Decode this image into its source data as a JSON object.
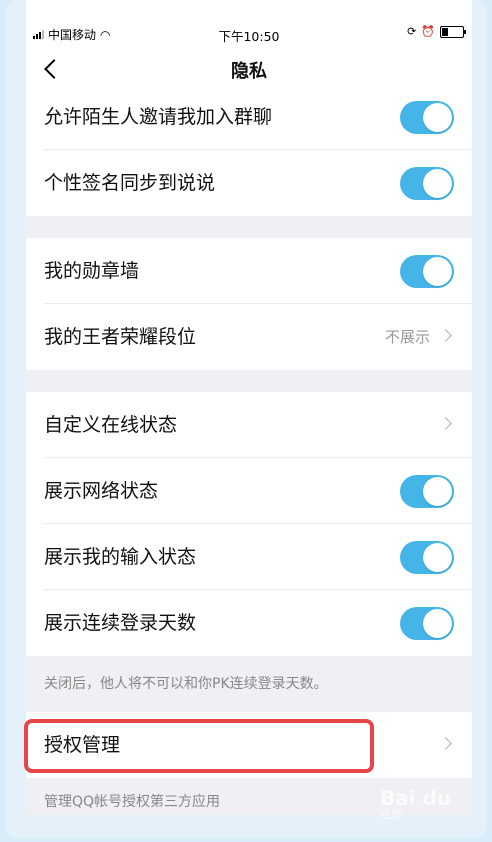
{
  "status_bar": {
    "carrier": "中国移动",
    "time": "下午10:50"
  },
  "nav": {
    "title": "隐私"
  },
  "rows": [
    {
      "label": "允许陌生人邀请我加入群聊",
      "toggle": true
    },
    {
      "label": "个性签名同步到说说",
      "toggle": true
    },
    {
      "label": "我的勋章墙",
      "toggle": true
    },
    {
      "label": "我的王者荣耀段位",
      "value": "不展示"
    },
    {
      "label": "自定义在线状态"
    },
    {
      "label": "展示网络状态",
      "toggle": true
    },
    {
      "label": "展示我的输入状态",
      "toggle": true
    },
    {
      "label": "展示连续登录天数",
      "toggle": true
    },
    {
      "label": "授权管理"
    }
  ],
  "footnotes": {
    "login_days": "关闭后，他人将不可以和你PK连续登录天数。",
    "auth": "管理QQ帐号授权第三方应用"
  },
  "watermark": {
    "text": "Bai du",
    "sub": "经验"
  },
  "colors": {
    "toggle_on": "#45b5e8",
    "highlight": "#e8454a",
    "background": "#efeff4"
  }
}
